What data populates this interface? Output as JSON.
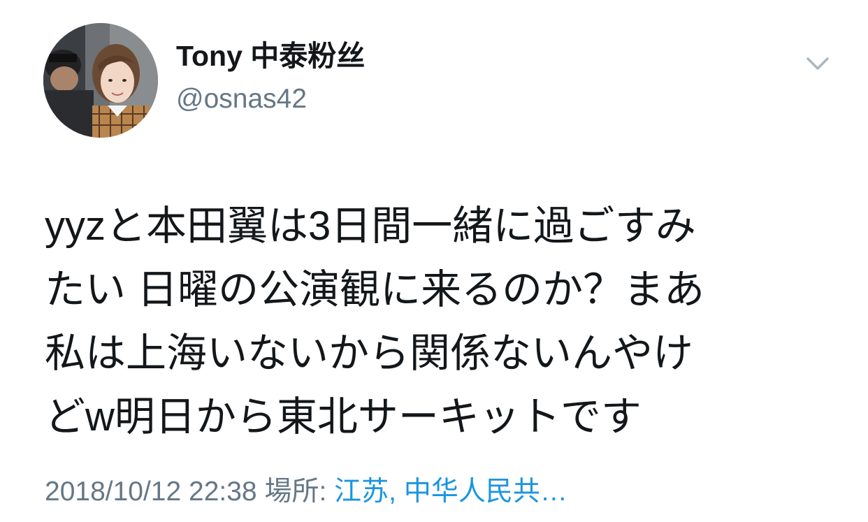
{
  "author": {
    "display_name": "Tony 中泰粉丝",
    "handle": "@osnas42",
    "avatar_icon": "profile-photo"
  },
  "menu": {
    "icon": "chevron-down-icon",
    "color": "#aab8c2"
  },
  "tweet": {
    "lines": [
      "yyzと本田翼は3日間一緒に過ごすみ",
      "たい 日曜の公演観に来るのか？まあ",
      "私は上海いないから関係ないんやけ",
      "どw明日から東北サーキットです"
    ]
  },
  "meta": {
    "timestamp": "2018/10/12 22:38",
    "location_label": "場所:",
    "location": "江苏, 中华人民共…"
  },
  "colors": {
    "text": "#14171a",
    "secondary": "#657786",
    "link": "#1b95e0"
  }
}
